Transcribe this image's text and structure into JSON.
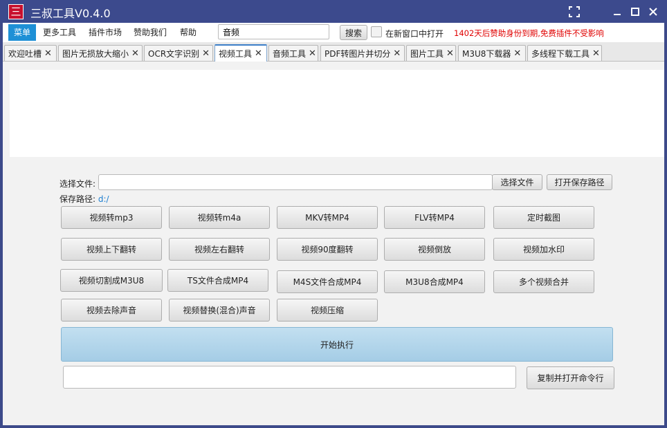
{
  "window": {
    "logo_glyph": "三",
    "title": "三叔工具V0.4.0",
    "fullscreen_glyph": "⛶",
    "minimize_glyph": "—",
    "maximize_glyph": "☐",
    "close_glyph": "✕"
  },
  "menubar": {
    "items": [
      "菜单",
      "更多工具",
      "插件市场",
      "赞助我们",
      "帮助"
    ],
    "search_value": "音频",
    "search_button": "搜索",
    "new_window_label": "在新窗口中打开",
    "notice": "1402天后赞助身份到期,免费插件不受影响",
    "accent_color": "#1e90d6",
    "notice_color": "#e00000"
  },
  "tabs": [
    {
      "label": "欢迎吐槽",
      "active": false
    },
    {
      "label": "图片无损放大缩小",
      "active": false
    },
    {
      "label": "OCR文字识别",
      "active": false
    },
    {
      "label": "视频工具",
      "active": true
    },
    {
      "label": "音频工具",
      "active": false
    },
    {
      "label": "PDF转图片并切分",
      "active": false
    },
    {
      "label": "图片工具",
      "active": false
    },
    {
      "label": "M3U8下载器",
      "active": false
    },
    {
      "label": "多线程下载工具",
      "active": false
    }
  ],
  "tab_close_glyph": "✕",
  "video_tool": {
    "select_file_label": "选择文件:",
    "select_file_value": "",
    "select_file_button": "选择文件",
    "open_save_path_button": "打开保存路径",
    "save_path_label": "保存路径:",
    "save_path_value": "d:/",
    "actions": [
      [
        "视频转mp3",
        "视频转m4a",
        "MKV转MP4",
        "FLV转MP4",
        "定时截图"
      ],
      [
        "视频上下翻转",
        "视频左右翻转",
        "视频90度翻转",
        "视频倒放",
        "视频加水印"
      ],
      [
        "视频切割成M3U8",
        "TS文件合成MP4",
        "M4S文件合成MP4",
        "M3U8合成MP4",
        "多个视频合并"
      ],
      [
        "视频去除声音",
        "视频替换(混合)声音",
        "视频压缩"
      ]
    ],
    "start_button": "开始执行",
    "command_value": "",
    "copy_command_button": "复制并打开命令行"
  }
}
